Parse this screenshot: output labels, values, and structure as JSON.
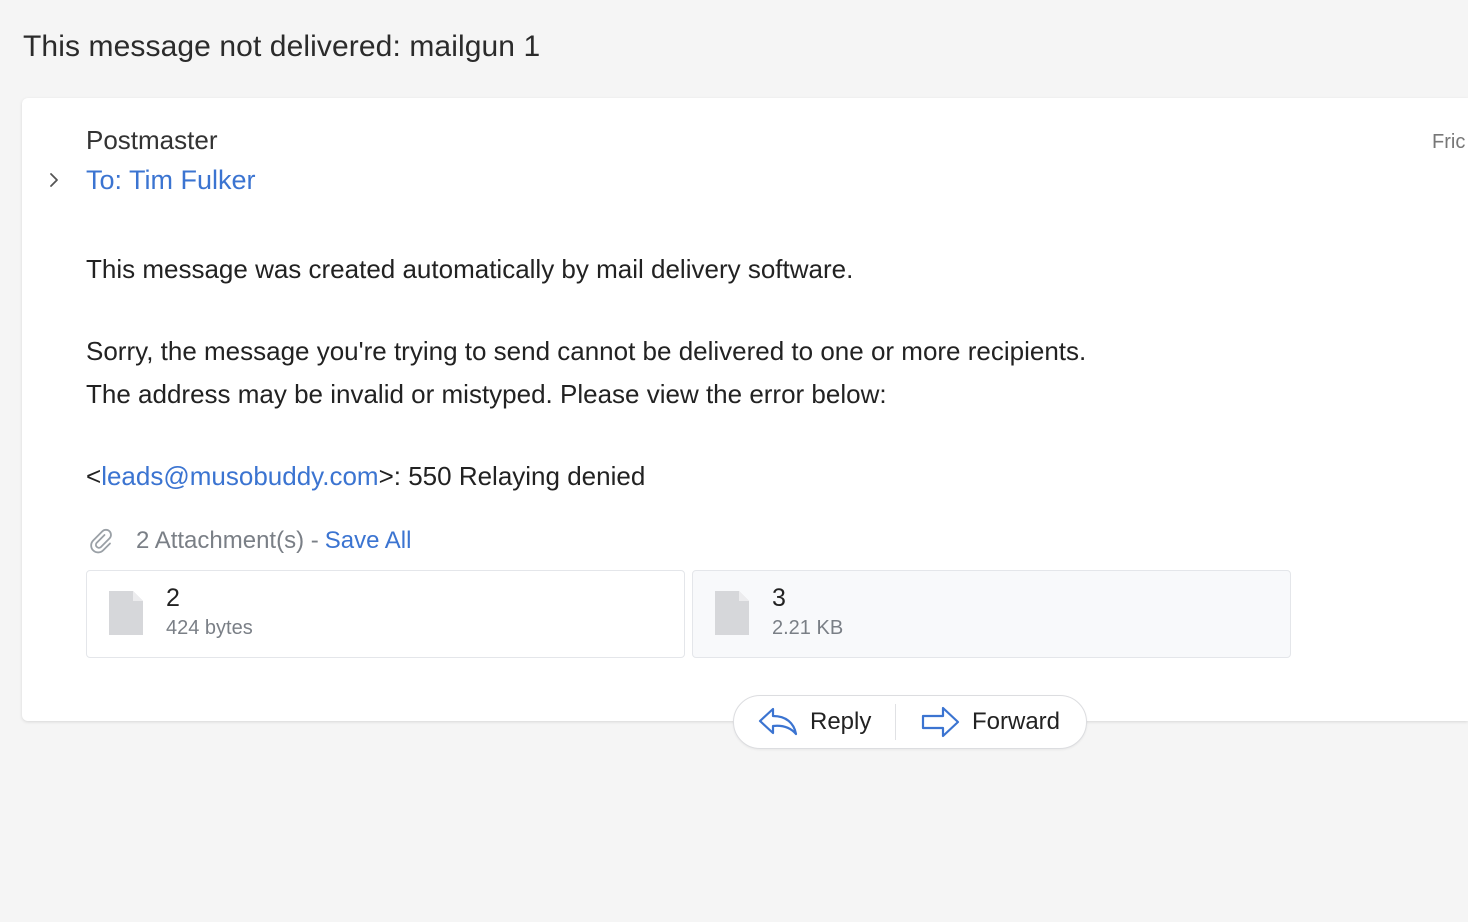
{
  "subject": "This message not delivered: mailgun 1",
  "message": {
    "sender": "Postmaster",
    "to_line": "To: Tim Fulker",
    "date": "Fric",
    "body": {
      "line1": "This message was created automatically by mail delivery software.",
      "line2": "Sorry, the message you're trying to send cannot be delivered to one or more recipients.",
      "line3": "The address may be invalid or mistyped. Please view the error below:",
      "error_prefix": "<",
      "error_link": "leads@musobuddy.com",
      "error_suffix": ">: 550 Relaying denied"
    }
  },
  "attachments": {
    "count_label": "2 Attachment(s) -",
    "save_all": "Save All",
    "items": [
      {
        "name": "2",
        "size": "424 bytes"
      },
      {
        "name": "3",
        "size": "2.21 KB"
      }
    ]
  },
  "actions": {
    "reply": "Reply",
    "forward": "Forward"
  },
  "colors": {
    "link": "#3b74d1",
    "background": "#f5f5f5",
    "card": "#ffffff"
  }
}
